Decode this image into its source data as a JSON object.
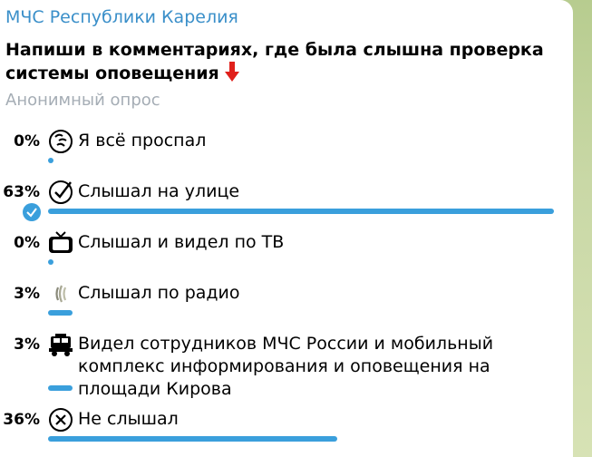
{
  "channel_name": "МЧС Республики Карелия",
  "question": "Напиши в комментариях, где была слышна проверка системы оповещения",
  "poll_type": "Анонимный опрос",
  "colors": {
    "accent": "#3a9fdc",
    "channel": "#3a8fc9",
    "arrow": "#e0201b"
  },
  "options": [
    {
      "percent_label": "0%",
      "value": 0,
      "icon": "sleeping-face-icon",
      "text": "Я всё проспал"
    },
    {
      "percent_label": "63%",
      "value": 63,
      "icon": "check-mark-icon",
      "text": "Слышал на улице",
      "chosen": true
    },
    {
      "percent_label": "0%",
      "value": 0,
      "icon": "television-icon",
      "text": "Слышал и видел по ТВ"
    },
    {
      "percent_label": "3%",
      "value": 3,
      "icon": "radio-waves-icon",
      "text": "Слышал по радио"
    },
    {
      "percent_label": "3%",
      "value": 3,
      "icon": "truck-icon",
      "text": "Видел сотрудников МЧС России и мобильный комплекс информирования и оповещения на площади Кирова"
    },
    {
      "percent_label": "36%",
      "value": 36,
      "icon": "cross-mark-icon",
      "text": "Не слышал"
    }
  ]
}
